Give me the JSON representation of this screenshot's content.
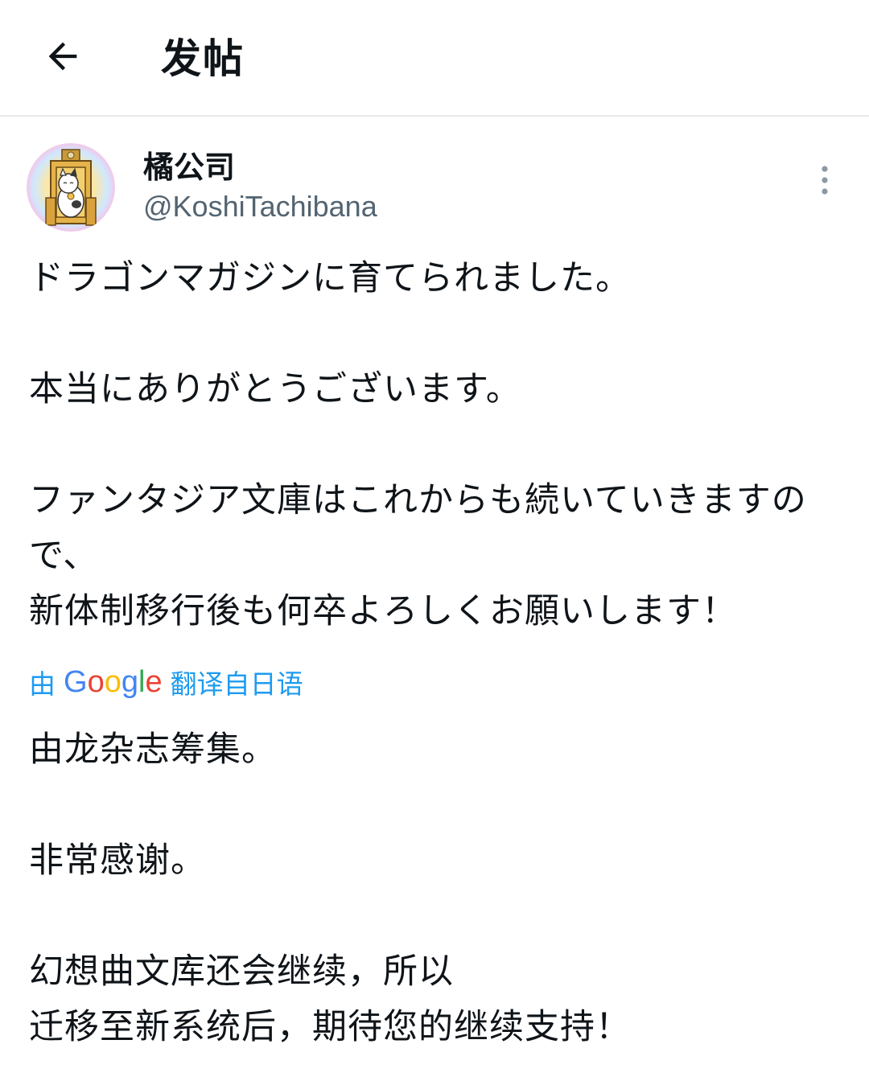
{
  "header": {
    "title": "发帖",
    "back_icon": "arrow-left-icon"
  },
  "author": {
    "name": "橘公司",
    "handle": "@KoshiTachibana"
  },
  "tweet": {
    "text": "ドラゴンマガジンに育てられました。\n\n本当にありがとうございます。\n\nファンタジア文庫はこれからも続いていきますので、\n新体制移行後も何卒よろしくお願いします！"
  },
  "translation": {
    "prefix": "由",
    "google": "Google",
    "suffix": "翻译自日语",
    "text": "由龙杂志筹集。\n\n非常感谢。\n\n幻想曲文库还会继续，所以\n迁移至新系统后，期待您的继续支持！"
  },
  "colors": {
    "accent": "#1d9bf0",
    "secondary_text": "#536471",
    "divider": "#e6e8ea"
  }
}
